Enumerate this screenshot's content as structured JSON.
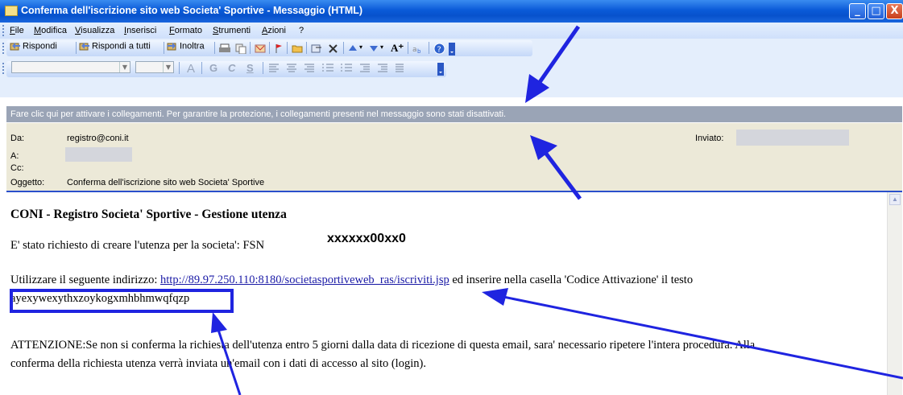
{
  "window": {
    "title": "Conferma dell'iscrizione sito web Societa' Sportive - Messaggio (HTML)",
    "controls": {
      "minimize": "_",
      "maximize": "□",
      "close": "X"
    }
  },
  "menu": [
    "File",
    "Modifica",
    "Visualizza",
    "Inserisci",
    "Formato",
    "Strumenti",
    "Azioni",
    "?"
  ],
  "toolbar": {
    "reply": "Rispondi",
    "reply_all": "Rispondi a tutti",
    "forward": "Inoltra"
  },
  "format_toolbar": {
    "bold": "G",
    "italic": "C",
    "underline": "S",
    "font_color": "A"
  },
  "infobar": "Fare clic qui per attivare i collegamenti. Per garantire la protezione, i collegamenti presenti nel messaggio sono stati disattivati.",
  "header": {
    "from_label": "Da:",
    "from_value": "registro@coni.it",
    "to_label": "A:",
    "cc_label": "Cc:",
    "subject_label": "Oggetto:",
    "subject_value": "Conferma dell'iscrizione sito web Societa' Sportive",
    "sent_label": "Inviato:"
  },
  "body": {
    "title": "CONI - Registro Societa' Sportive - Gestione utenza",
    "line1": "E' stato richiesto di creare l'utenza per la societa': FSN",
    "redacted_code": "xxxxxx00xx0",
    "line2_pre": "Utilizzare il seguente indirizzo: ",
    "link": "http://89.97.250.110:8180/societasportiveweb_ras/iscriviti.jsp",
    "line2_post": " ed inserire nella casella 'Codice Attivazione' il testo",
    "activation_code": "ayexywexythxzoykogxmhbhmwqfqzp",
    "warning_line1": "ATTENZIONE:Se non si conferma la richiesta dell'utenza entro 5 giorni dalla data di ricezione di questa email, sara' necessario ripetere l'intera procedura. Alla",
    "warning_line2": "conferma della richiesta utenza verrà inviata un'email con i dati di accesso al sito (login)."
  },
  "colors": {
    "titlebar": "#0a5ad8",
    "infobar": "#9aa4b6",
    "header_bg": "#ece9d8",
    "annotation": "#1f24e0"
  }
}
